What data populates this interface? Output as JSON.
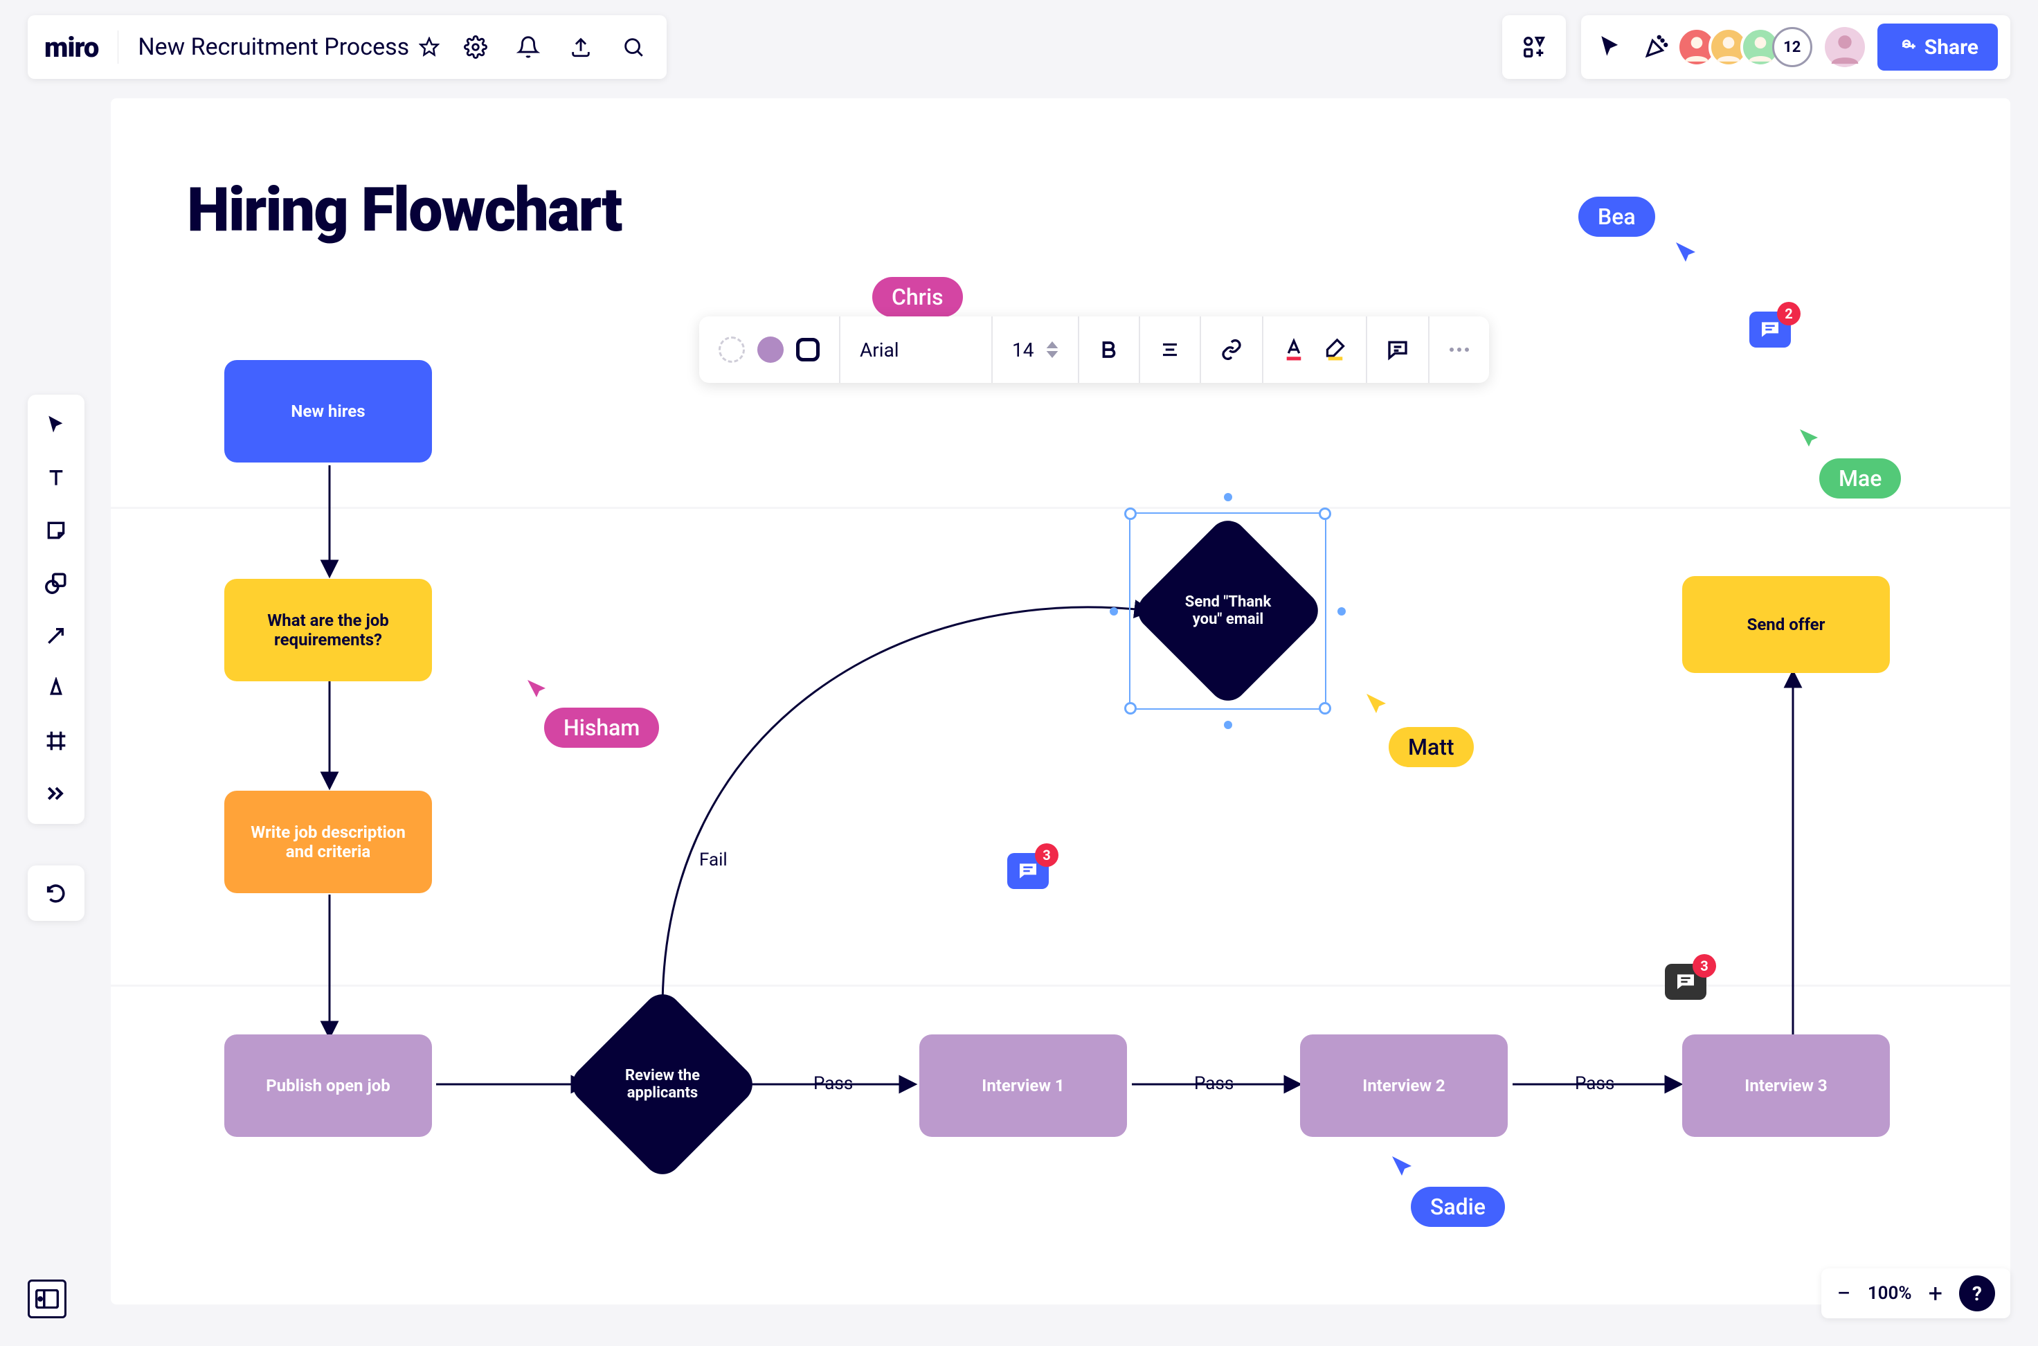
{
  "app": {
    "logo": "miro",
    "board_title": "New Recruitment Process"
  },
  "collaborators": {
    "extra_count": "12"
  },
  "header": {
    "share_label": "Share"
  },
  "canvas": {
    "title": "Hiring Flowchart"
  },
  "nodes": {
    "new_hires": "New hires",
    "requirements": "What are the job requirements?",
    "write_jd": "Write job description and criteria",
    "publish": "Publish open job",
    "review": "Review the applicants",
    "thank_you": "Send \"Thank you\" email",
    "interview1": "Interview 1",
    "interview2": "Interview 2",
    "interview3": "Interview 3",
    "send_offer": "Send offer"
  },
  "edges": {
    "fail": "Fail",
    "pass1": "Pass",
    "pass2": "Pass",
    "pass3": "Pass"
  },
  "cursors": {
    "chris": "Chris",
    "bea": "Bea",
    "hisham": "Hisham",
    "mae": "Mae",
    "matt": "Matt",
    "sadie": "Sadie"
  },
  "comments": {
    "c1": "3",
    "c2": "3",
    "c3": "2"
  },
  "format_bar": {
    "font": "Arial",
    "size": "14"
  },
  "zoom": {
    "level": "100%"
  }
}
